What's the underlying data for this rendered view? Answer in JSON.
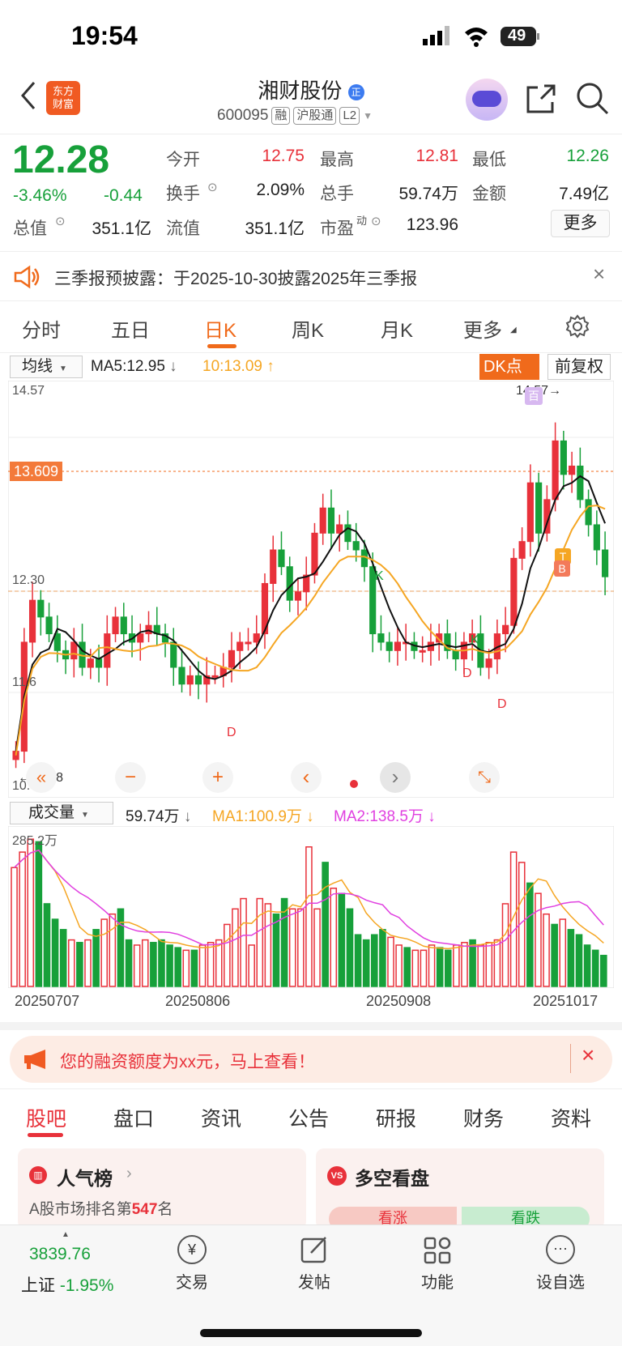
{
  "status": {
    "time": "19:54",
    "battery": "49"
  },
  "header": {
    "brand_logo": "东方\n财富",
    "title": "湘财股份",
    "title_badge": "正",
    "code": "600095",
    "tags": [
      "融",
      "沪股通",
      "L2"
    ]
  },
  "quote": {
    "price": "12.28",
    "change_pct": "-3.46%",
    "change": "-0.44",
    "open_label": "今开",
    "open": "12.75",
    "high_label": "最高",
    "high": "12.81",
    "low_label": "最低",
    "low": "12.26",
    "turnover_label": "换手",
    "turnover": "2.09%",
    "volume_label": "总手",
    "volume": "59.74万",
    "amount_label": "金额",
    "amount": "7.49亿",
    "mktcap_label": "总值",
    "mktcap": "351.1亿",
    "float_label": "流值",
    "float": "351.1亿",
    "pe_label": "市盈",
    "pe_sup": "动",
    "pe": "123.96",
    "more_label": "更多"
  },
  "notice": {
    "text": "三季报预披露：于2025-10-30披露2025年三季报"
  },
  "k_tabs": [
    "分时",
    "五日",
    "日K",
    "周K",
    "月K",
    "更多"
  ],
  "k_tab_active": "日K",
  "ma_bar": {
    "selector": "均线",
    "ma5": "MA5:12.95",
    "ma10": "10:13.09",
    "dk": "DK点",
    "restore": "前复权"
  },
  "main_chart": {
    "y_labels": [
      "14.57",
      "12.30",
      "10.08"
    ],
    "mid_label_partial": "11.6",
    "hl_label": "13.609",
    "max_marker": "14.57→",
    "min_marker": "←10.08",
    "top_badge": "百",
    "b_badge": "B",
    "t_badge": "T",
    "letters": [
      {
        "t": "K",
        "c": "#17a03a"
      },
      {
        "t": "D",
        "c": "#e8313a"
      },
      {
        "t": "K",
        "c": "#17a03a"
      },
      {
        "t": "D",
        "c": "#e8313a"
      },
      {
        "t": "D",
        "c": "#e8313a"
      }
    ]
  },
  "chart_controls": [
    "«",
    "−",
    "+",
    "‹",
    "›",
    "⤡"
  ],
  "vol_bar": {
    "selector": "成交量",
    "vol": "59.74万",
    "ma1": "MA1:100.9万",
    "ma2": "MA2:138.5万"
  },
  "vol_chart": {
    "y_label": "285.2万",
    "dates": [
      "20250707",
      "20250806",
      "20250908",
      "20251017"
    ]
  },
  "promo": {
    "text": "您的融资额度为xx元，马上查看！"
  },
  "section_tabs": [
    "股吧",
    "盘口",
    "资讯",
    "公告",
    "研报",
    "财务",
    "资料"
  ],
  "cards": {
    "popularity": {
      "title": "人气榜",
      "rank_prefix": "A股市场排名第",
      "rank": "547",
      "rank_suffix": "名"
    },
    "longshort": {
      "title": "多空看盘",
      "up": "看涨",
      "down": "看跌"
    }
  },
  "tabbar": {
    "index_value": "3839.76",
    "index_name": "上证",
    "index_change": "-1.95%",
    "items": [
      "交易",
      "发帖",
      "功能",
      "设自选"
    ]
  },
  "colors": {
    "up": "#e8313a",
    "down": "#17a03a",
    "accent": "#f06a1b",
    "ma10": "#f5a623",
    "ma2": "#e040e0"
  }
}
